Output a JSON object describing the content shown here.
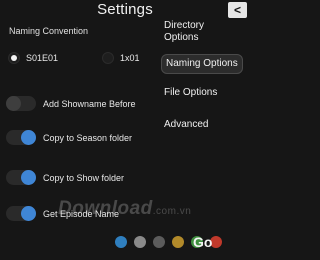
{
  "window": {
    "title": "Settings",
    "back_glyph": "<"
  },
  "naming": {
    "section_label": "Naming Convention",
    "options": [
      {
        "label": "S01E01",
        "selected": true
      },
      {
        "label": "1x01",
        "selected": false
      }
    ]
  },
  "toggles": [
    {
      "label": "Add Showname Before",
      "on": false
    },
    {
      "label": "Copy to Season folder",
      "on": true
    },
    {
      "label": "Copy to Show folder",
      "on": true
    },
    {
      "label": "Get Episode Name",
      "on": true
    }
  ],
  "sidebar": {
    "items": [
      {
        "label": "Directory Options",
        "active": false
      },
      {
        "label": "Naming Options",
        "active": true
      },
      {
        "label": "File Options",
        "active": false
      },
      {
        "label": "Advanced",
        "active": false
      }
    ]
  },
  "watermark": {
    "text": "Download",
    "suffix": ".com.vn"
  },
  "theme_colors": [
    "#2f7fbf",
    "#8a8a8a",
    "#5c5c5c",
    "#b28a2a",
    "#3f8f3f",
    "#c0392b"
  ],
  "go_label": "Go",
  "accent_color": "#3f86d6"
}
